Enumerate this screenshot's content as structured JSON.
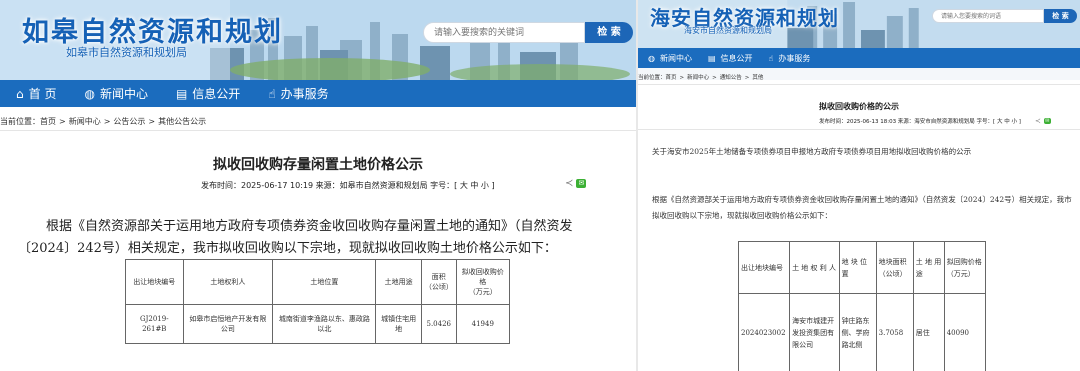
{
  "left": {
    "site_title": "如皋自然资源和规划",
    "site_subtitle": "如皋市自然资源和规划局",
    "search": {
      "placeholder": "请输入要搜索的关键词",
      "button": "检 索"
    },
    "nav": [
      {
        "label": "首  页",
        "icon": "home-icon"
      },
      {
        "label": "新闻中心",
        "icon": "globe-icon"
      },
      {
        "label": "信息公开",
        "icon": "document-icon"
      },
      {
        "label": "办事服务",
        "icon": "thumbs-up-icon"
      }
    ],
    "breadcrumb": [
      "当前位置：首页",
      "新闻中心",
      "公告公示",
      "其他公告公示"
    ],
    "title": "拟收回收购存量闲置土地价格公示",
    "meta": "发布时间：2025-06-17 10:19  来源：如皋市自然资源和规划局  字号：[ 大 中 小 ]",
    "paragraph": "根据《自然资源部关于运用地方政府专项债券资金收回收购存量闲置土地的通知》（自然资发〔2024〕242号）相关规定，我市拟收回收购以下宗地，现就拟收回收购土地价格公示如下：",
    "table": {
      "headers": [
        "出让地块编号",
        "土地权利人",
        "土地位置",
        "土地用途",
        "面积\n（公顷）",
        "拟收回收购价格\n（万元）"
      ],
      "rows": [
        [
          "GJ2019-261#B",
          "如皋市启恒地产开发有限公司",
          "城南街道李渔路以东、惠政路以北",
          "城镇住宅用地",
          "5.0426",
          "41949"
        ]
      ]
    }
  },
  "right": {
    "site_title": "海安自然资源和规划",
    "site_subtitle": "海安市自然资源和规划局",
    "search": {
      "placeholder": "请输入您要搜索的词语",
      "button": "检 索"
    },
    "nav": [
      {
        "label": "新闻中心",
        "icon": "globe-icon"
      },
      {
        "label": "信息公开",
        "icon": "document-icon"
      },
      {
        "label": "办事服务",
        "icon": "thumbs-up-icon"
      }
    ],
    "breadcrumb": [
      "当前位置：首页",
      "新闻中心",
      "通知公告",
      "其他"
    ],
    "title": "拟收回收购价格的公示",
    "meta": "发布时间：2025-06-13 18:03  来源：海安市自然资源和规划局  字号：[ 大 中 小 ]",
    "paragraph1": "关于海安市2025年土地储备专项债券项目申报地方政府专项债券项目用地拟收回收购价格的公示",
    "paragraph2": "根据《自然资源部关于运用地方政府专项债券资金收回收购存量闲置土地的通知》（自然资发〔2024〕242号）相关规定，我市拟收回收购以下宗地，现就拟收回收购价格公示如下：",
    "table": {
      "headers": [
        "出让地块编号",
        "土 地 权 利 人",
        "地 块 位 置",
        "地块面积（公顷）",
        "土 地 用 途",
        "拟回购价格（万元）"
      ],
      "rows": [
        [
          "2024023002",
          "海安市城建开发投资集团有限公司",
          "钟庄路东侧、学府路北侧",
          "3.7058",
          "居住",
          "40090"
        ]
      ]
    }
  }
}
